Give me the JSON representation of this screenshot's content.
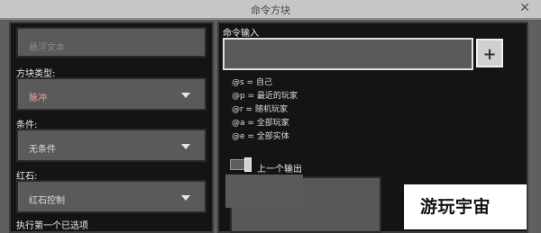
{
  "window": {
    "title": "命令方块",
    "close_symbol": "✕"
  },
  "left": {
    "name_placeholder": "悬浮文本",
    "block_type_label": "方块类型:",
    "block_type_value": "脉冲",
    "condition_label": "条件:",
    "condition_value": "无条件",
    "redstone_label": "红石:",
    "redstone_value": "红石控制",
    "execute_first_label": "执行第一个已选项"
  },
  "right": {
    "command_input_label": "命令输入",
    "command_input_value": "",
    "add_button_symbol": "+",
    "selector_help": [
      "@s = 自己",
      "@p = 最近的玩家",
      "@r = 随机玩家",
      "@a = 全部玩家",
      "@e = 全部实体"
    ],
    "previous_output_label": "上一个输出",
    "output_text": "-"
  },
  "watermark": {
    "text": "游玩宇宙"
  },
  "colors": {
    "block_type_value": "#e6a393",
    "panel_bg": "#141414",
    "field_bg": "#5a5a5a"
  }
}
